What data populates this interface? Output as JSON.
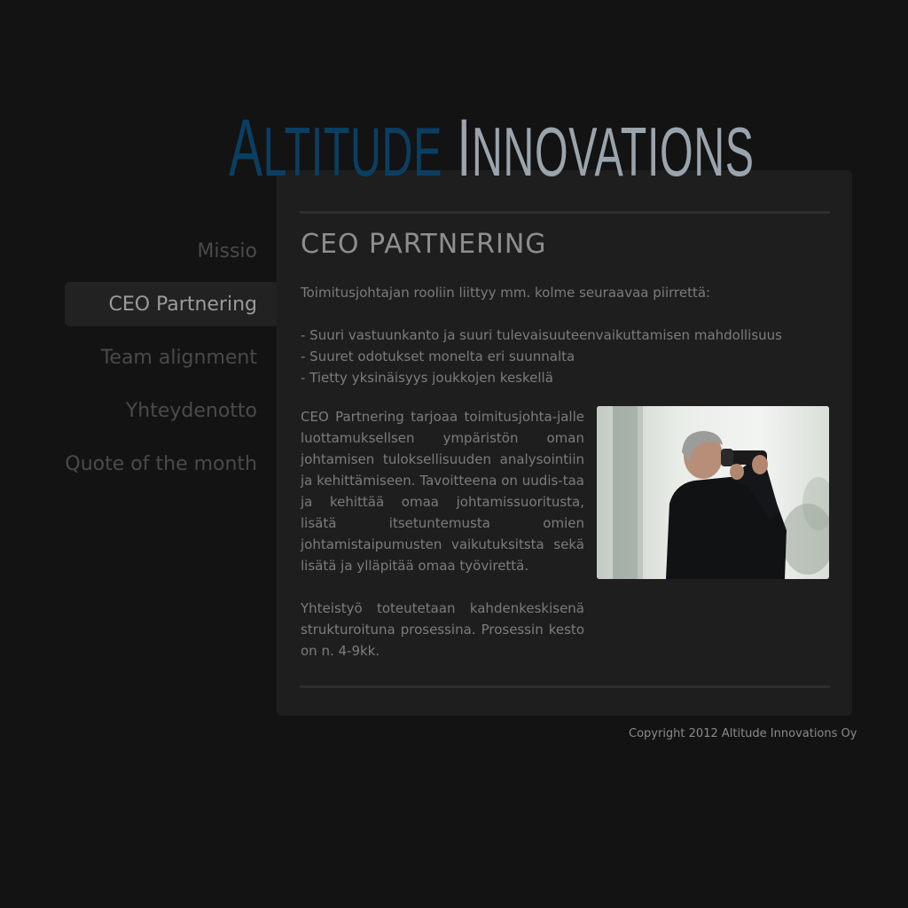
{
  "logo": {
    "word1_first": "A",
    "word1_rest": "LTITUDE",
    "word2_first": "I",
    "word2_rest": "NNOVATIONS",
    "colors": {
      "word1": "#0a3f63",
      "word2": "#9aa4ad"
    }
  },
  "nav": {
    "items": [
      {
        "label": "Missio",
        "active": false
      },
      {
        "label": "CEO Partnering",
        "active": true
      },
      {
        "label": "Team alignment",
        "active": false
      },
      {
        "label": "Yhteydenotto",
        "active": false
      },
      {
        "label": "Quote of the month",
        "active": false
      }
    ]
  },
  "content": {
    "heading": "CEO PARTNERING",
    "intro": "Toimitusjohtajan rooliin liittyy mm. kolme seuraavaa piirrettä:",
    "bullets": [
      "- Suuri vastuunkanto ja suuri tulevaisuuteenvaikuttamisen mahdollisuus",
      "- Suuret odotukset monelta eri suunnalta",
      "- Tietty yksinäisyys joukkojen keskellä"
    ],
    "paragraph1": "CEO Partnering tarjoaa toimitusjohta-jalle luottamuksellsen ympäristön oman johtamisen tuloksellisuuden analysointiin ja kehittämiseen. Tavoitteena on uudis-taa ja kehittää omaa johtamissuoritusta, lisätä itsetuntemusta omien johtamistaipumusten vaikutuksitsta sekä lisätä ja ylläpitää omaa työvirettä.",
    "paragraph2": "Yhteistyö toteutetaan kahdenkeskisenä strukturoituna prosessina. Prosessin kesto on n. 4-9kk.",
    "photo_icon": "man-with-binoculars-photo"
  },
  "footer": {
    "copyright": "Copyright 2012 Altitude Innovations Oy"
  }
}
